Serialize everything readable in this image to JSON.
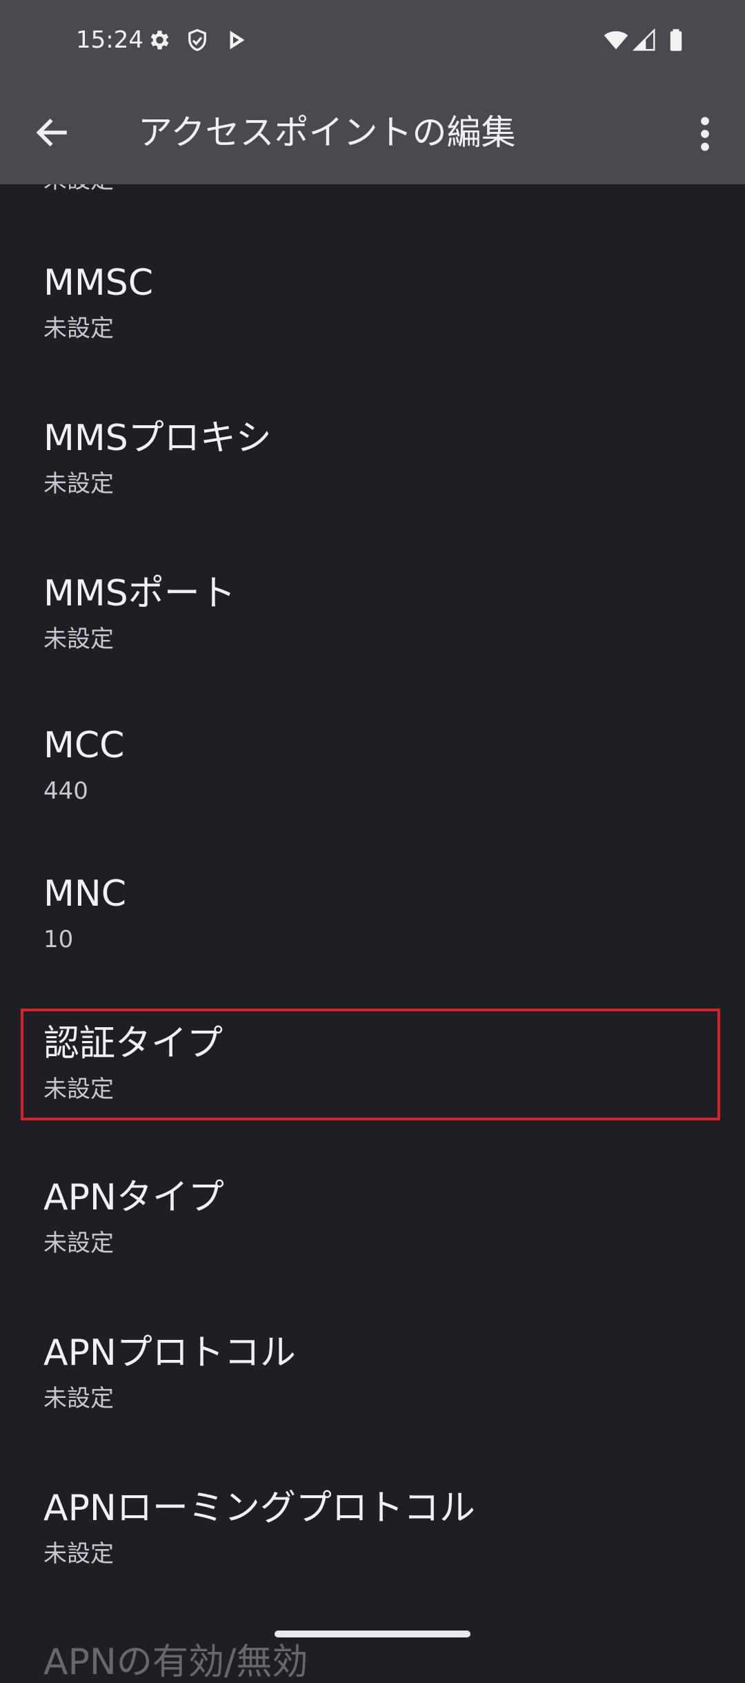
{
  "status_bar": {
    "time": "15:24",
    "icons": [
      "settings-icon",
      "shield-icon",
      "play-store-icon",
      "wifi-icon",
      "signal-icon",
      "battery-icon"
    ]
  },
  "app_bar": {
    "title": "アクセスポイントの編集",
    "back_icon": "arrow-back-icon",
    "more_icon": "more-vert-icon"
  },
  "list": {
    "partial_top_sub": "未設定",
    "items": [
      {
        "title": "MMSC",
        "value": "未設定"
      },
      {
        "title": "MMSプロキシ",
        "value": "未設定"
      },
      {
        "title": "MMSポート",
        "value": "未設定"
      },
      {
        "title": "MCC",
        "value": "440"
      },
      {
        "title": "MNC",
        "value": "10"
      },
      {
        "title": "認証タイプ",
        "value": "未設定"
      },
      {
        "title": "APNタイプ",
        "value": "未設定"
      },
      {
        "title": "APNプロトコル",
        "value": "未設定"
      },
      {
        "title": "APNローミングプロトコル",
        "value": "未設定"
      }
    ],
    "partial_bottom_title": "APNの有効/無効"
  },
  "highlighted_item": "認証タイプ",
  "colors": {
    "background": "#1f1e24",
    "app_bar": "#4a494f",
    "highlight": "#d3232a"
  }
}
